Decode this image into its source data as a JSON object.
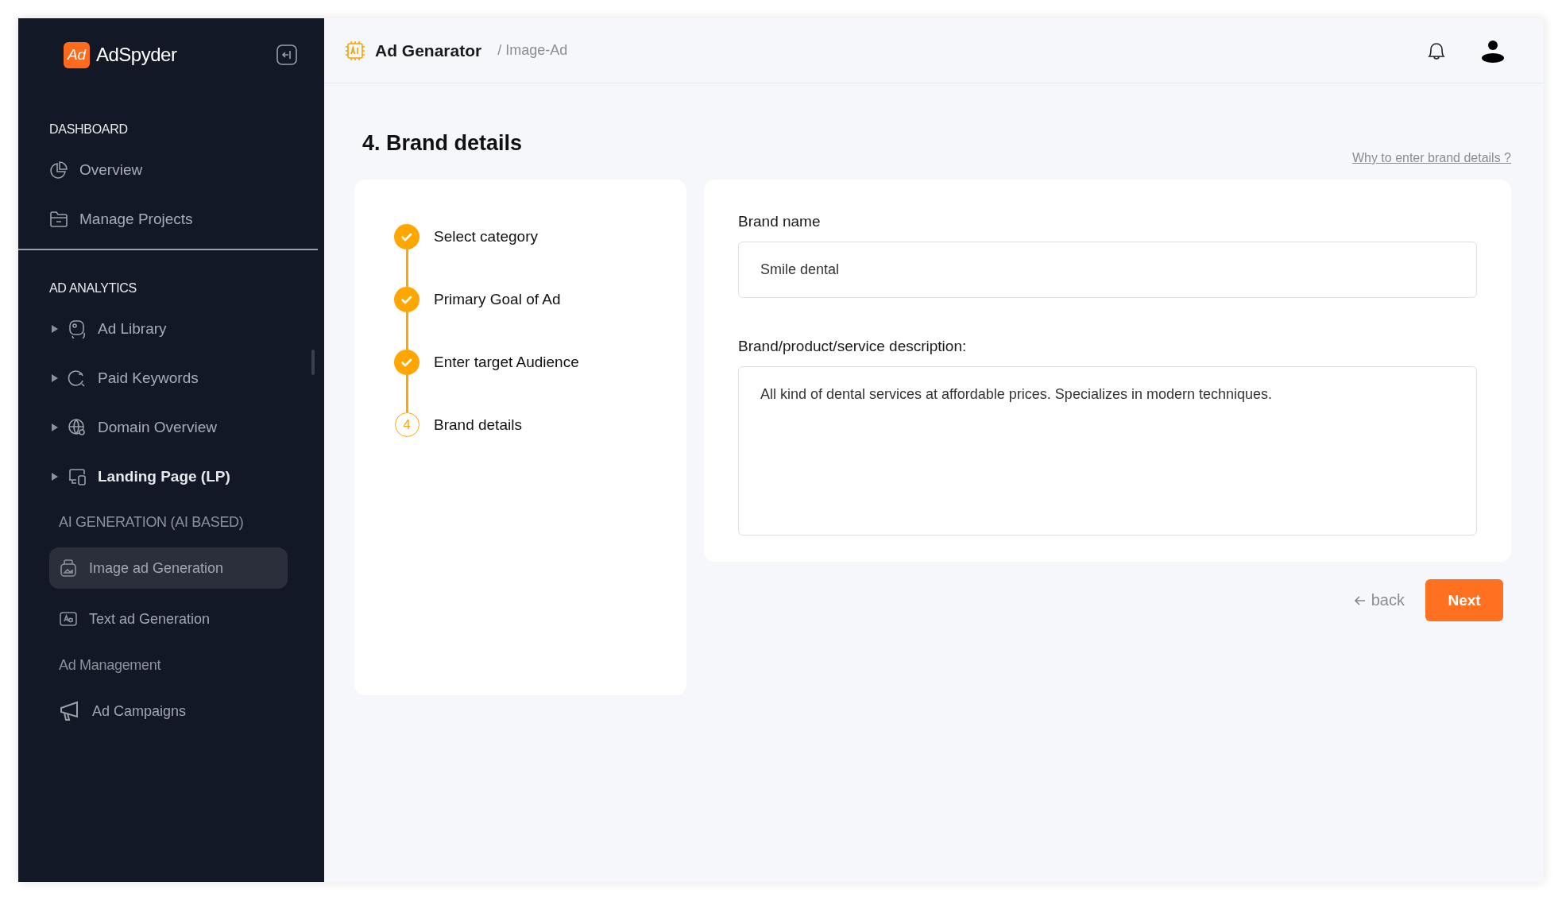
{
  "sidebar": {
    "logo": {
      "text": "AdSpyder",
      "mark": "Ad"
    },
    "sections": [
      {
        "heading": "DASHBOARD",
        "kind": "caps",
        "items": [
          {
            "label": "Overview",
            "selected": false
          },
          {
            "label": "Manage Projects",
            "selected": false
          }
        ]
      },
      {
        "heading": "AD ANALYTICS",
        "kind": "caps",
        "items": [
          {
            "label": "Ad Library",
            "expanded": false,
            "selected": false,
            "emphasized": false
          },
          {
            "label": "Paid Keywords",
            "expanded": false,
            "selected": false,
            "emphasized": false
          },
          {
            "label": "Domain Overview",
            "expanded": false,
            "selected": false,
            "emphasized": false
          },
          {
            "label": "Landing Page (LP)",
            "expanded": false,
            "selected": false,
            "emphasized": true
          }
        ]
      },
      {
        "heading": "AI GENERATION (AI BASED)",
        "kind": "muted",
        "items": [
          {
            "label": "Image ad Generation",
            "selected": true
          },
          {
            "label": "Text ad Generation",
            "selected": false
          }
        ]
      },
      {
        "heading": "Ad Management",
        "kind": "muted",
        "items": [
          {
            "label": "Ad Campaigns",
            "selected": false
          }
        ]
      }
    ]
  },
  "header": {
    "title": "Ad Genarator",
    "breadcrumb": "/ Image-Ad"
  },
  "page": {
    "title": "4. Brand details",
    "help_link": "Why to enter brand details ?"
  },
  "steps": [
    {
      "label": "Select category",
      "done": true
    },
    {
      "label": "Primary Goal of Ad",
      "done": true
    },
    {
      "label": "Enter target Audience",
      "done": true
    },
    {
      "label": "Brand details",
      "done": false,
      "number": "4"
    }
  ],
  "form": {
    "fields": [
      {
        "kind": "input",
        "label": "Brand name",
        "value": "Smile dental"
      },
      {
        "kind": "textarea",
        "label": "Brand/product/service description:",
        "value": "All kind of dental services at affordable prices. Specializes in modern techniques."
      }
    ]
  },
  "actions": {
    "back": "back",
    "next": "Next"
  }
}
